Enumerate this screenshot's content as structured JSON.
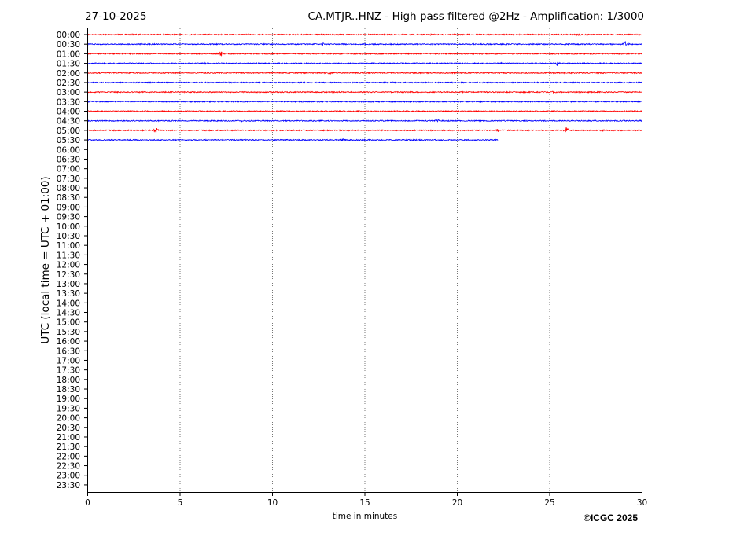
{
  "header": {
    "date": "27-10-2025",
    "title": "CA.MTJR..HNZ - High pass filtered @2Hz - Amplification: 1/3000"
  },
  "footer": {
    "copyright": "©ICGC 2025"
  },
  "chart_data": {
    "type": "line",
    "title": "CA.MTJR..HNZ - High pass filtered @2Hz - Amplification: 1/3000",
    "xlabel": "time in minutes",
    "ylabel": "UTC (local time = UTC + 01:00)",
    "xlim": [
      0,
      30
    ],
    "xticks": [
      "0",
      "5",
      "10",
      "15",
      "20",
      "25",
      "30"
    ],
    "grid_x": [
      5,
      10,
      15,
      20,
      25
    ],
    "row_labels": [
      "00:00",
      "00:30",
      "01:00",
      "01:30",
      "02:00",
      "02:30",
      "03:00",
      "03:30",
      "04:00",
      "04:30",
      "05:00",
      "05:30",
      "06:00",
      "06:30",
      "07:00",
      "07:30",
      "08:00",
      "08:30",
      "09:00",
      "09:30",
      "10:00",
      "10:30",
      "11:00",
      "11:30",
      "12:00",
      "12:30",
      "13:00",
      "13:30",
      "14:00",
      "14:30",
      "15:00",
      "15:30",
      "16:00",
      "16:30",
      "17:00",
      "17:30",
      "18:00",
      "18:30",
      "19:00",
      "19:30",
      "20:00",
      "20:30",
      "21:00",
      "21:30",
      "22:00",
      "22:30",
      "23:00",
      "23:30"
    ],
    "colors": [
      "#ff0000",
      "#0000ff"
    ],
    "series": [
      {
        "row": "00:00",
        "end_minute": 30,
        "events": [
          [
            26.6,
            1.5
          ],
          [
            18.5,
            1
          ]
        ]
      },
      {
        "row": "00:30",
        "end_minute": 30,
        "events": [
          [
            12.7,
            3
          ],
          [
            28.4,
            1.5
          ],
          [
            29.1,
            4
          ]
        ]
      },
      {
        "row": "01:00",
        "end_minute": 30,
        "events": [
          [
            7.2,
            6
          ],
          [
            14.1,
            1.5
          ]
        ]
      },
      {
        "row": "01:30",
        "end_minute": 30,
        "events": [
          [
            6.3,
            1.5
          ],
          [
            22.4,
            1.5
          ],
          [
            25.4,
            3
          ]
        ]
      },
      {
        "row": "02:00",
        "end_minute": 30,
        "events": [
          [
            13.1,
            1.5
          ],
          [
            19.4,
            1.5
          ]
        ]
      },
      {
        "row": "02:30",
        "end_minute": 30,
        "events": []
      },
      {
        "row": "03:00",
        "end_minute": 30,
        "events": [
          [
            25.2,
            1
          ]
        ]
      },
      {
        "row": "03:30",
        "end_minute": 30,
        "events": [
          [
            0.1,
            2
          ],
          [
            27.0,
            1.5
          ]
        ]
      },
      {
        "row": "04:00",
        "end_minute": 30,
        "events": [
          [
            22.3,
            1
          ]
        ]
      },
      {
        "row": "04:30",
        "end_minute": 30,
        "events": [
          [
            8.3,
            3
          ],
          [
            18.9,
            3
          ]
        ]
      },
      {
        "row": "05:00",
        "end_minute": 30,
        "events": [
          [
            3.7,
            5
          ],
          [
            22.2,
            2
          ],
          [
            25.9,
            7
          ],
          [
            27.9,
            1.5
          ]
        ]
      },
      {
        "row": "05:30",
        "end_minute": 22.2,
        "events": [
          [
            13.8,
            3
          ]
        ]
      }
    ]
  }
}
